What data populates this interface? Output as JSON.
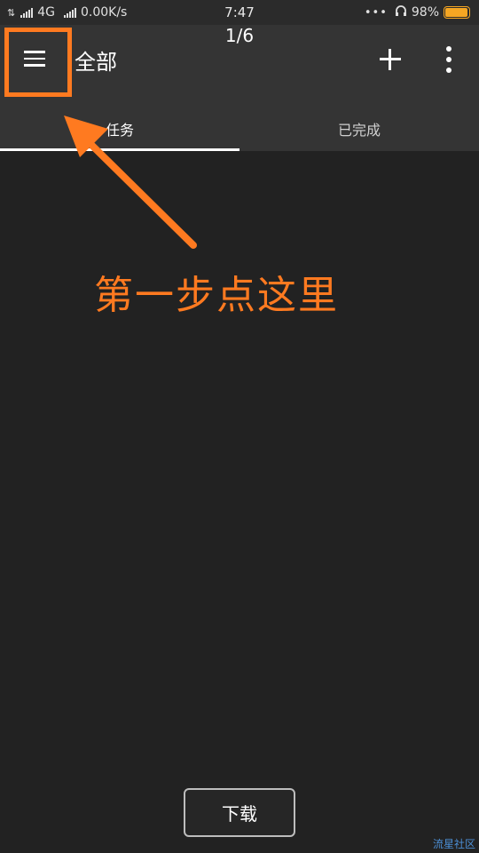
{
  "status_bar": {
    "network_type": "4G",
    "speed": "0.00K/s",
    "time": "7:47",
    "dots": "•••",
    "battery_percent": "98%",
    "battery_level": 0.98,
    "battery_color": "#f5a623"
  },
  "app_bar": {
    "page_counter": "1/6",
    "title": "全部",
    "menu_icon": "hamburger-menu-icon",
    "add_icon": "plus-icon",
    "more_icon": "more-vertical-icon"
  },
  "tabs": [
    {
      "label": "任务",
      "active": true
    },
    {
      "label": "已完成",
      "active": false
    }
  ],
  "annotation": {
    "text": "第一步点这里",
    "color": "#ff7a20"
  },
  "download_button": {
    "label": "下载"
  },
  "watermark": "流星社区"
}
